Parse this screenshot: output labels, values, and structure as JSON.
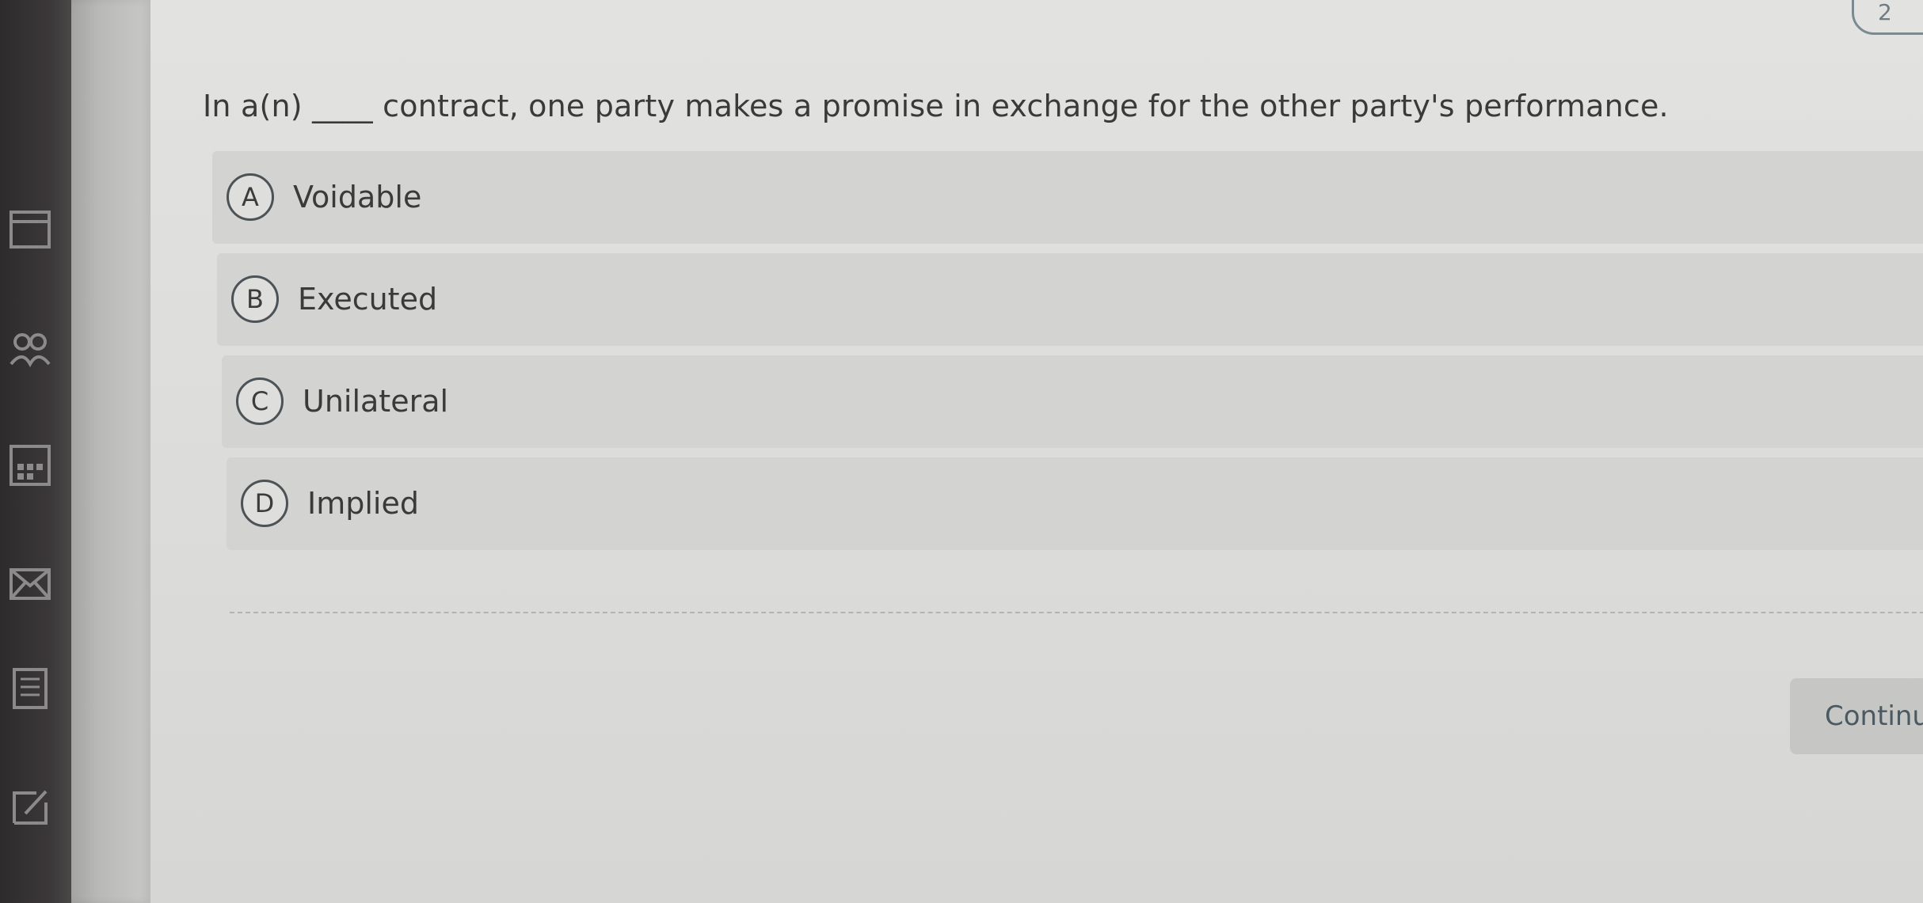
{
  "question": {
    "text": "In a(n) ____ contract, one party makes a promise in exchange for the other party's performance."
  },
  "options": [
    {
      "letter": "A",
      "label": "Voidable"
    },
    {
      "letter": "B",
      "label": "Executed"
    },
    {
      "letter": "C",
      "label": "Unilateral"
    },
    {
      "letter": "D",
      "label": "Implied"
    }
  ],
  "continue_button": {
    "label": "Continu"
  },
  "top_chip": {
    "label": "2"
  },
  "sidebar": {
    "icons": [
      "book-icon",
      "people-icon",
      "calculator-icon",
      "mail-icon",
      "document-icon",
      "edit-icon"
    ]
  },
  "colors": {
    "sidebar": "#3b3839",
    "option_bg": "#d3d3d1",
    "accent_text": "#4a5a62"
  }
}
